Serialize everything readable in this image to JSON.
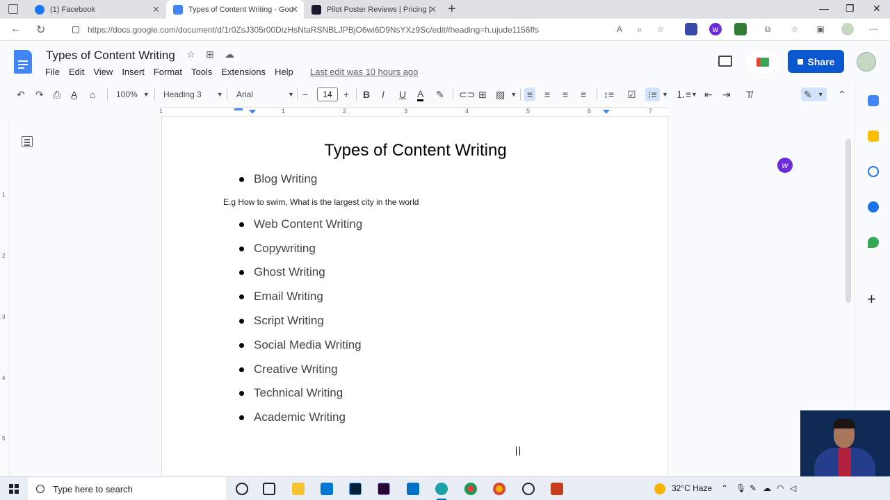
{
  "browser": {
    "tabs": [
      {
        "label": "(1) Facebook",
        "icon": "facebook-icon",
        "color": "#1877f2"
      },
      {
        "label": "Types of Content Writing - Google Docs",
        "icon": "google-docs-icon",
        "color": "#4285f4"
      },
      {
        "label": "Pilot Poster Reviews | Pricing | Features",
        "icon": "pilot-poster-icon",
        "color": "#1a1a2e"
      }
    ],
    "url": "https://docs.google.com/document/d/1r0ZsJ305r00DizHsNtaRSNBLJPBjO6wi6D9NsYXz9Sc/edit#heading=h.ujude1156ffs"
  },
  "docs": {
    "title": "Types of Content Writing",
    "menu": [
      "File",
      "Edit",
      "View",
      "Insert",
      "Format",
      "Tools",
      "Extensions",
      "Help"
    ],
    "last_edit": "Last edit was 10 hours ago",
    "share_label": "Share"
  },
  "toolbar": {
    "zoom": "100%",
    "style": "Heading 3",
    "font": "Arial",
    "font_size": "14"
  },
  "ruler": [
    "1",
    "1",
    "2",
    "3",
    "4",
    "5",
    "6",
    "7"
  ],
  "vruler": [
    "1",
    "2",
    "3",
    "4",
    "5"
  ],
  "document": {
    "heading": "Types of Content Writing",
    "first_item": "Blog Writing",
    "paragraph": "E.g How to swim, What is the largest city in the world",
    "items": [
      "Web Content Writing",
      "Copywriting",
      "Ghost Writing",
      "Email Writing",
      "Script Writing",
      "Social Media Writing",
      "Creative Writing",
      "Technical Writing",
      "Academic Writing"
    ]
  },
  "taskbar": {
    "search_placeholder": "Type here to search",
    "weather": "32°C  Haze"
  },
  "colors": {
    "docs_blue": "#4285f4",
    "share_blue": "#0b57d0",
    "active_tool": "#d3e3fd"
  }
}
